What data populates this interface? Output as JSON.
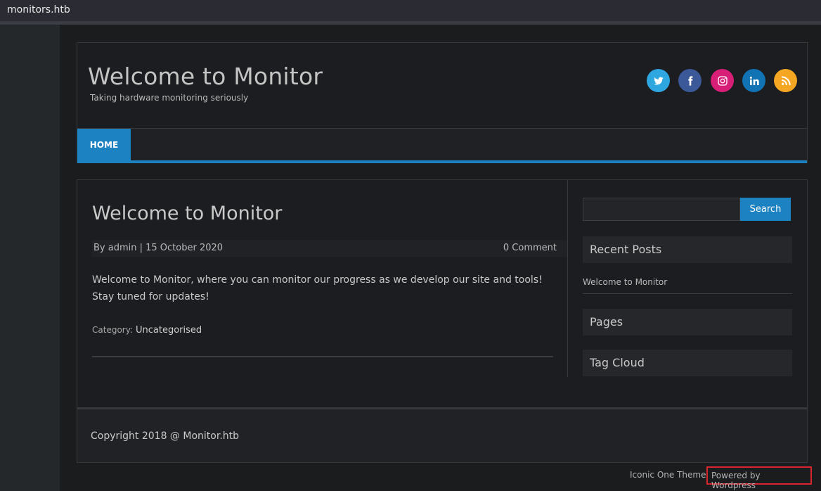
{
  "window": {
    "host": "monitors.htb"
  },
  "header": {
    "title": "Welcome to Monitor",
    "tagline": "Taking hardware monitoring seriously",
    "social": [
      {
        "icon": "twitter-icon",
        "glyph": "t",
        "color": "#2ea7e0"
      },
      {
        "icon": "facebook-icon",
        "glyph": "f",
        "color": "#3b5998"
      },
      {
        "icon": "instagram-icon",
        "glyph": "◎",
        "color": "#d81f78"
      },
      {
        "icon": "linkedin-icon",
        "glyph": "in",
        "color": "#1173b3"
      },
      {
        "icon": "rss-icon",
        "glyph": "))",
        "color": "#f5a623"
      }
    ]
  },
  "nav": {
    "home": "HOME"
  },
  "post": {
    "title": "Welcome to Monitor",
    "byline": "By admin | 15 October 2020",
    "comments": "0 Comment",
    "body": "Welcome to Monitor, where you can monitor our progress as we develop our site and tools! Stay tuned for updates!",
    "category_label": "Category:",
    "category": "Uncategorised"
  },
  "sidebar": {
    "search_button": "Search",
    "recent_posts_title": "Recent Posts",
    "recent_posts": [
      "Welcome to Monitor"
    ],
    "pages_title": "Pages",
    "tag_cloud_title": "Tag Cloud"
  },
  "footer": {
    "copyright": "Copyright 2018 @ Monitor.htb",
    "theme_credit": "Iconic One Theme",
    "powered_by": "Powered by Wordpress"
  },
  "colors": {
    "accent": "#1d82c1",
    "highlight_box": "#d6252d"
  }
}
